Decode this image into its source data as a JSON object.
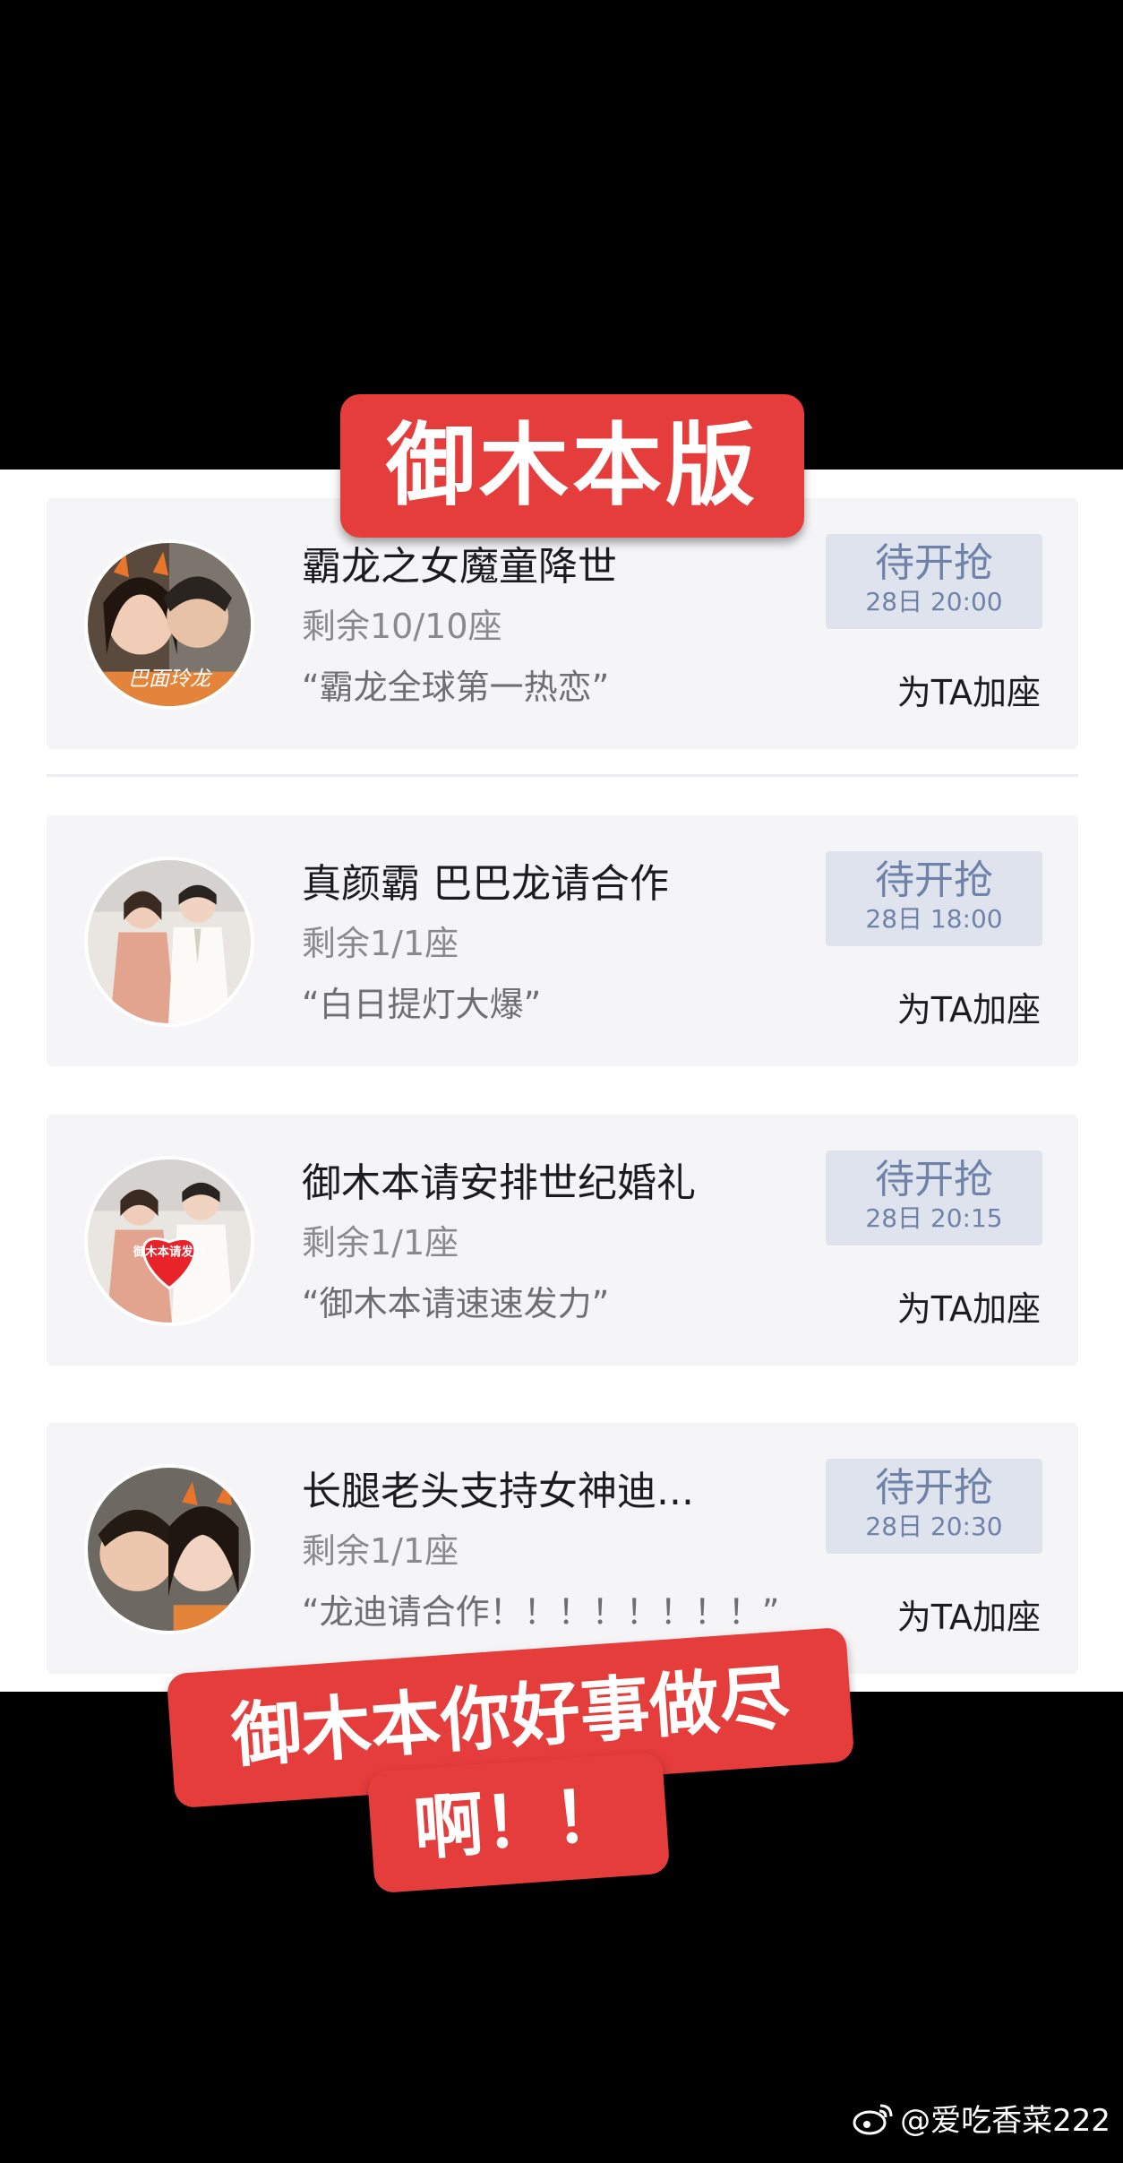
{
  "banner_top": "御木本版",
  "banner_bottom_line1": "御木本你好事做尽",
  "banner_bottom_line2": "啊！！",
  "watermark": "@爱吃香菜222",
  "cards": [
    {
      "title": "霸龙之女魔童降世",
      "remaining": "剩余10/10座",
      "quote": "“霸龙全球第一热恋”",
      "status": "待开抢",
      "time": "28日 20:00",
      "action": "为TA加座",
      "avatar_caption": "巴面玲龙"
    },
    {
      "title": "真颜霸 巴巴龙请合作",
      "remaining": "剩余1/1座",
      "quote": "“白日提灯大爆”",
      "status": "待开抢",
      "time": "28日 18:00",
      "action": "为TA加座"
    },
    {
      "title": "御木本请安排世纪婚礼",
      "remaining": "剩余1/1座",
      "quote": "“御木本请速速发力”",
      "status": "待开抢",
      "time": "28日 20:15",
      "action": "为TA加座",
      "avatar_caption": "御木本请发力"
    },
    {
      "title": "长腿老头支持女神迪...",
      "remaining": "剩余1/1座",
      "quote": "“龙迪请合作！！！！！！！！”",
      "status": "待开抢",
      "time": "28日 20:30",
      "action": "为TA加座"
    }
  ],
  "colors": {
    "banner": "#e53c3c",
    "card_bg": "#f5f5f8",
    "grab_bg": "#dee3ee",
    "grab_text": "#6f82a8"
  }
}
